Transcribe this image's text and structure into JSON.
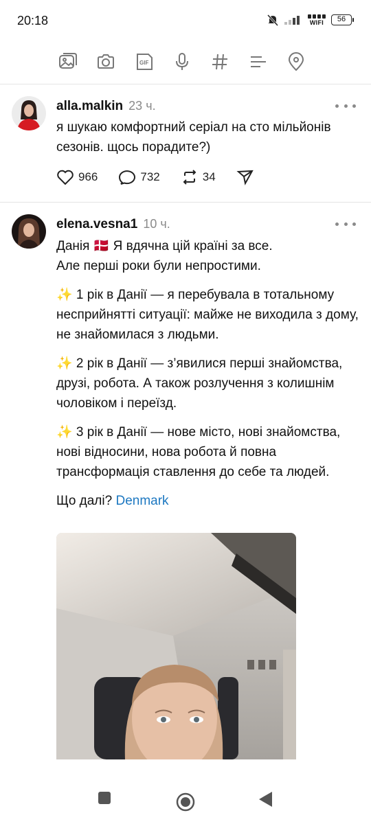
{
  "status_bar": {
    "time": "20:18",
    "network_label": "WIFI",
    "battery": "56"
  },
  "toolbar": {
    "icons": [
      "gallery-icon",
      "camera-icon",
      "gif-icon",
      "microphone-icon",
      "hashtag-icon",
      "list-icon",
      "location-icon"
    ],
    "gif_label": "GIF",
    "icon_color": "#777777"
  },
  "posts": [
    {
      "username": "alla.malkin",
      "time": "23 ч.",
      "text": "я шукаю комфортний серіал на сто мільйонів сезонів. щось порадите?)",
      "likes": "966",
      "comments": "732",
      "reposts": "34"
    },
    {
      "username": "elena.vesna1",
      "time": "10 ч.",
      "paragraphs": [
        "Данія 🇩🇰 Я вдячна цій країні за все.\nАле перші роки були непростими.",
        "✨ 1 рік в Данії — я перебувала в тотальному несприйнятті ситуації: майже не виходила з дому, не знайомилася з людьми.",
        "✨ 2 рік в Данії — з’явилися перші знайомства, друзі, робота. А також розлучення з колишнім чоловіком і переїзд.",
        "✨ 3 рік в Данії — нове місто, нові знайомства, нові відносини, нова робота й повна трансформація ставлення до себе та людей."
      ],
      "closing_text": "Що далі? ",
      "tag_link": "Denmark"
    }
  ],
  "colors": {
    "link": "#1d78c1",
    "muted": "#8a8a8a",
    "divider": "#e4e4e4"
  },
  "navbar": {
    "icons": [
      "recent-apps-icon",
      "home-icon",
      "back-icon"
    ]
  }
}
